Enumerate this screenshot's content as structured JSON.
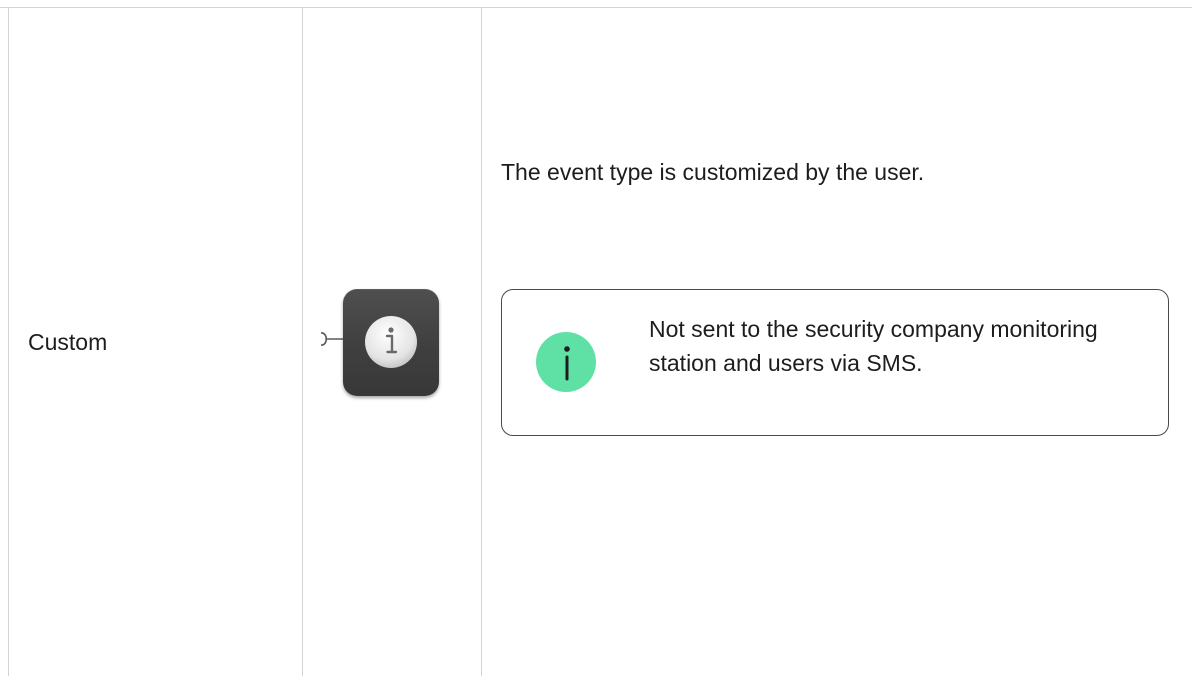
{
  "row": {
    "name": "Custom",
    "icon": "info-icon",
    "description": "The event type is customized by the user.",
    "note": {
      "icon": "info-icon",
      "text": "Not sent to the security company monitoring station and users via SMS."
    }
  },
  "colors": {
    "border": "#d4d4d4",
    "tile": "#454545",
    "note_icon": "#5fe0a4",
    "note_border": "#4a4a4a"
  }
}
